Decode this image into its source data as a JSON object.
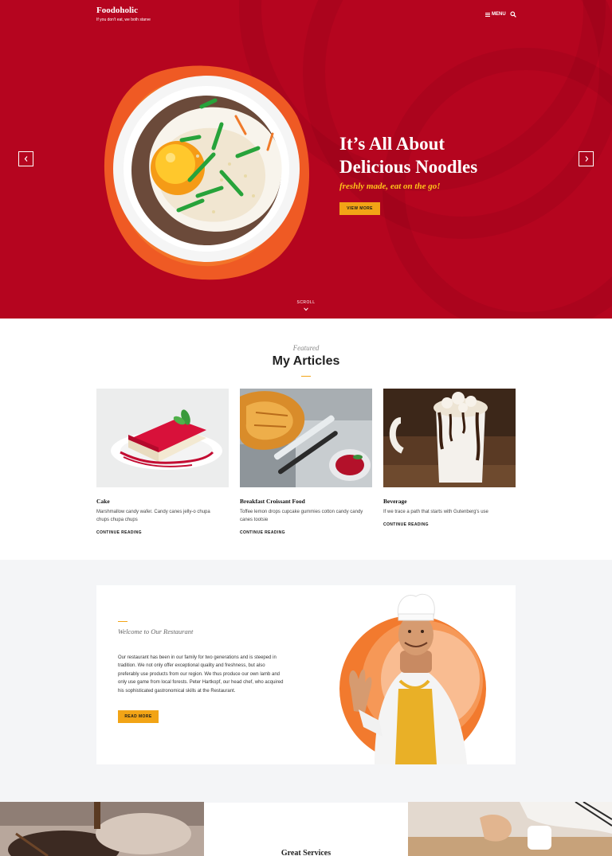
{
  "header": {
    "site_title": "Foodoholic",
    "tagline": "If you don't eat, we both starve",
    "menu_label": "MENU"
  },
  "hero": {
    "title": "It’s All About Delicious Noodles",
    "subtitle": "freshly made, eat on the go!",
    "button_label": "VIEW MORE",
    "scroll_label": "SCROLL"
  },
  "articles": {
    "section_label": "Featured",
    "title": "My Articles",
    "items": [
      {
        "title": "Cake",
        "excerpt": "Marshmallow candy wafer. Candy canes jelly-o chupa chups chupa chups",
        "more": "CONTINUE READING"
      },
      {
        "title": "Breakfast Croissant Food",
        "excerpt": "Toffee lemon drops cupcake gummies cotton candy candy canes tootsie",
        "more": "CONTINUE READING"
      },
      {
        "title": "Beverage",
        "excerpt": "If we trace a path that starts with Gutenberg's use",
        "more": "CONTINUE READING"
      }
    ]
  },
  "welcome": {
    "label": "Welcome to Our Restaurant",
    "body": "Our restaurant has been in our family for two generations and is steeped in tradition. We not only offer exceptional quality and freshness, but also preferably use products from our region. We thus produce our own lamb and only use game from local forests. Peter Hartkopf, our head chef, who acquired his sophisticated gastronomical skills at the Restaurant.",
    "button_label": "READ MORE"
  },
  "services": {
    "title": "Great Services"
  },
  "colors": {
    "hero_red": "#b5051f",
    "accent_yellow": "#f2a416",
    "subtitle_yellow": "#ffc41a",
    "section_grey": "#f4f5f7"
  }
}
